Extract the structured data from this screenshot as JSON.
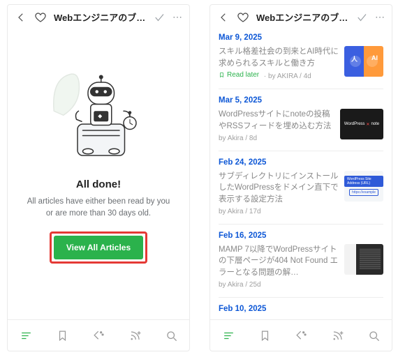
{
  "header": {
    "title": "Webエンジニアのブログ"
  },
  "empty_state": {
    "heading": "All done!",
    "subtext": "All articles have either been read by you or are more than 30 days old.",
    "button_label": "View All Articles"
  },
  "articles": [
    {
      "date": "Mar 9, 2025",
      "title": "スキル格差社会の到来とAI時代に求められるスキルと働き方",
      "read_later": "Read later",
      "byline": "by AKIRA / 4d",
      "thumb_left": "人",
      "thumb_right": "AI"
    },
    {
      "date": "Mar 5, 2025",
      "title": "WordPressサイトにnoteの投稿やRSSフィードを埋め込む方法",
      "byline": "by Akira / 8d",
      "thumb_wp": "WordPress",
      "thumb_note": "note"
    },
    {
      "date": "Feb 24, 2025",
      "title": "サブディレクトリにインストールしたWordPressをドメイン直下で表示する設定方法",
      "byline": "by Akira / 17d",
      "thumb_bar1": "WordPress Site Address (URL)"
    },
    {
      "date": "Feb 16, 2025",
      "title": "MAMP 7以降でWordPressサイトの下層ページが404 Not Found エラーとなる問題の解…",
      "byline": "by Akira / 25d"
    },
    {
      "date": "Feb 10, 2025"
    }
  ]
}
